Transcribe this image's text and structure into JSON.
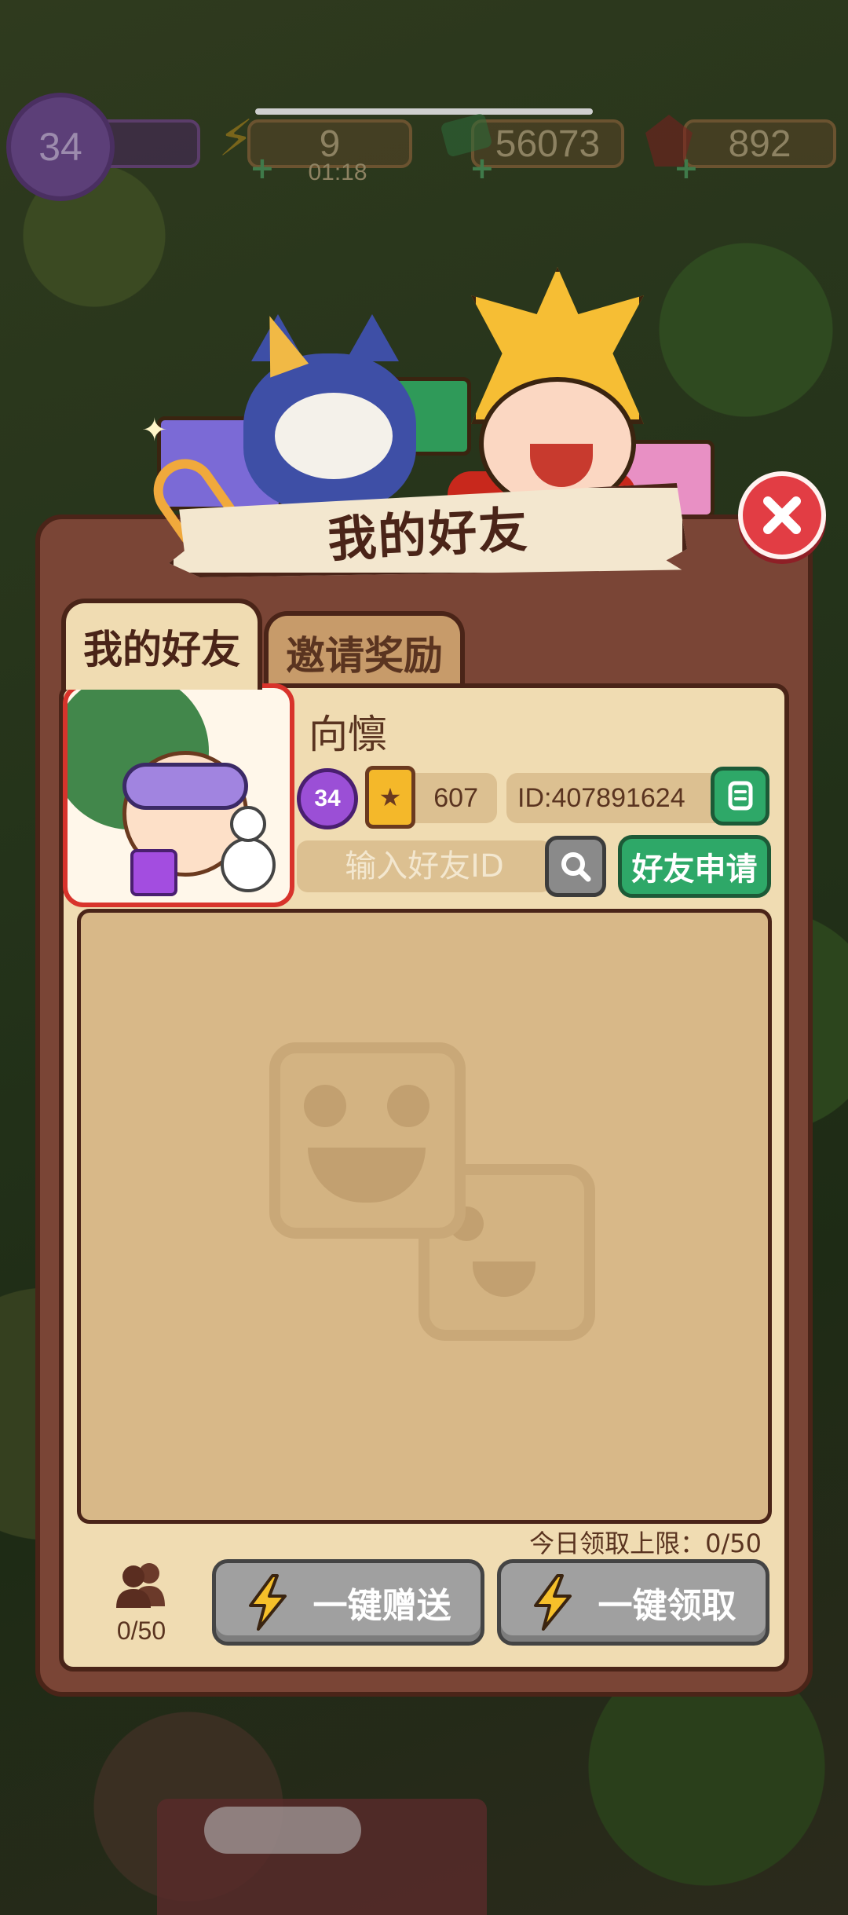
{
  "status_bar": {
    "level": "34",
    "energy": "9",
    "energy_timer": "01:18",
    "cash": "56073",
    "gems": "892"
  },
  "dialog": {
    "title": "我的好友",
    "close_icon": "close-icon"
  },
  "tabs": [
    {
      "label": "我的好友",
      "active": true
    },
    {
      "label": "邀请奖励",
      "active": false
    }
  ],
  "profile": {
    "name": "向懔",
    "level": "34",
    "score": "607",
    "id_text": "ID:407891624"
  },
  "add_friend": {
    "placeholder": "输入好友ID",
    "apply_label": "好友申请"
  },
  "footer": {
    "daily_limit": "今日领取上限：0/50",
    "friend_count": "0/50",
    "send_all_label": "一键赠送",
    "claim_all_label": "一键领取"
  },
  "colors": {
    "panel": "#7a4536",
    "panel_inner": "#f0dcb2",
    "accent_green": "#2ea868",
    "close_red": "#e23d44",
    "disabled_gray": "#a0a0a0"
  }
}
